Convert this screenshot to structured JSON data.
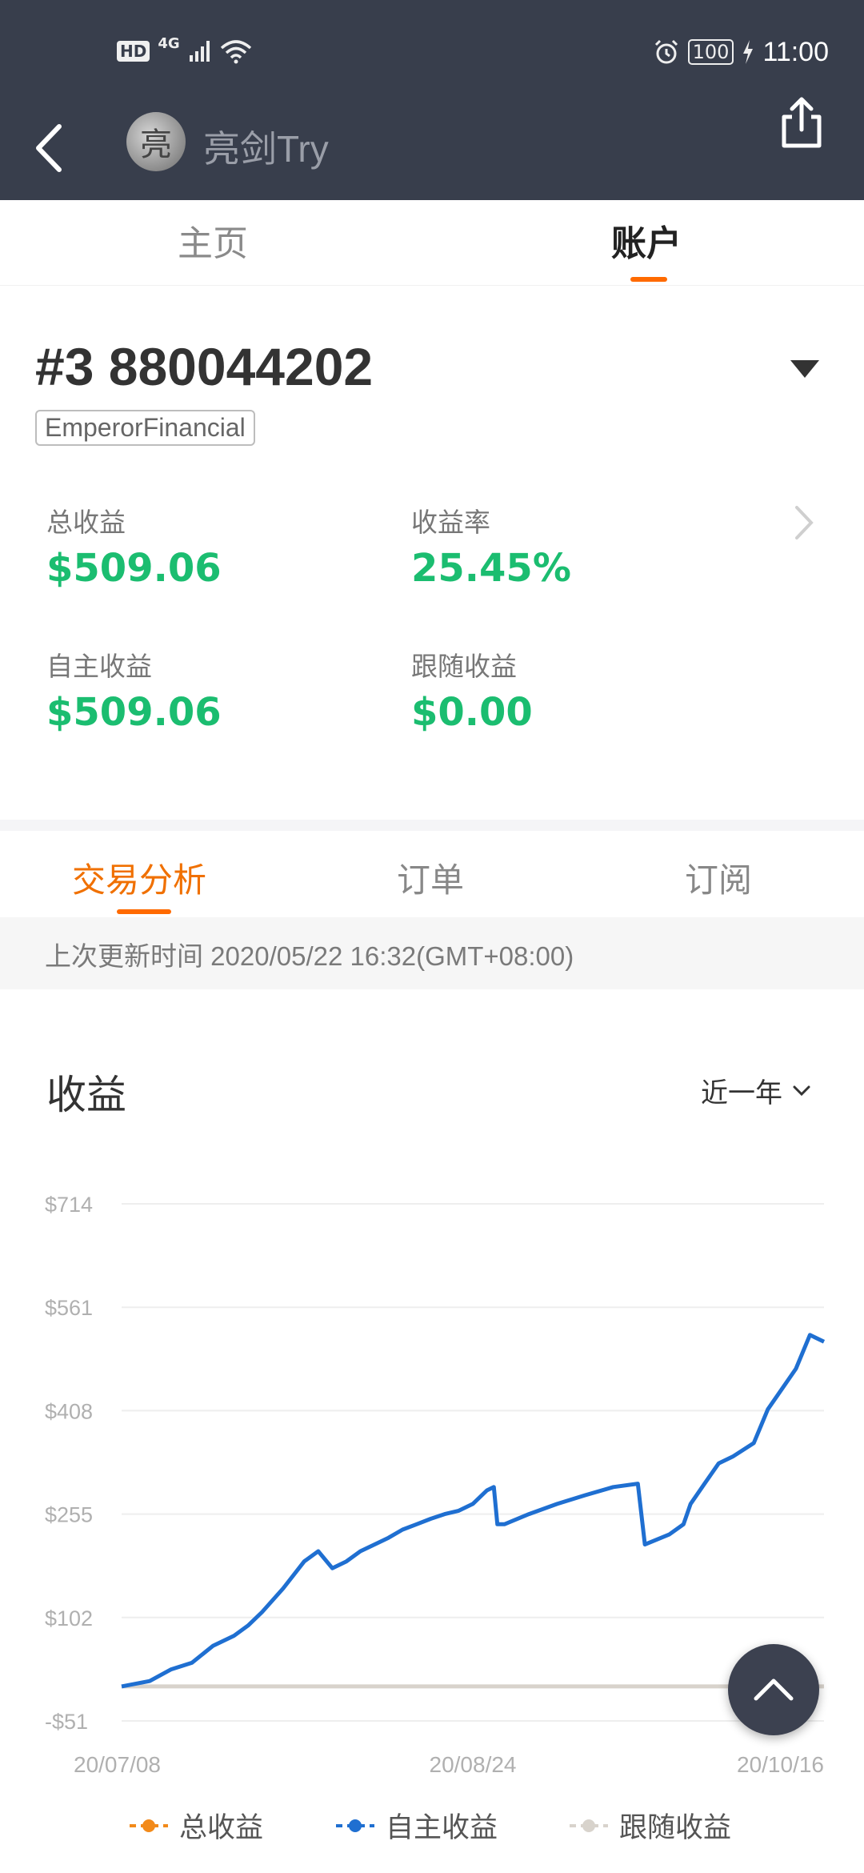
{
  "status_bar": {
    "hd": "HD",
    "network": "4G",
    "battery": "100",
    "time": "11:00"
  },
  "app_bar": {
    "title": "亮剑Try",
    "avatar_text": "亮"
  },
  "top_tabs": [
    {
      "label": "主页",
      "active": false
    },
    {
      "label": "账户",
      "active": true
    }
  ],
  "account": {
    "id": "#3 880044202",
    "broker": "EmperorFinancial"
  },
  "stats": [
    {
      "label": "总收益",
      "value": "$509.06"
    },
    {
      "label": "收益率",
      "value": "25.45%"
    },
    {
      "label": "自主收益",
      "value": "$509.06"
    },
    {
      "label": "跟随收益",
      "value": "$0.00"
    }
  ],
  "sub_tabs": [
    {
      "label": "交易分析",
      "active": true
    },
    {
      "label": "订单",
      "active": false
    },
    {
      "label": "订阅",
      "active": false
    }
  ],
  "last_update": "上次更新时间 2020/05/22 16:32(GMT+08:00)",
  "earnings_section": {
    "title": "收益",
    "range": "近一年"
  },
  "colors": {
    "accent": "#ff6a00",
    "positive": "#1bbd70",
    "series_total": "#f28a1a",
    "series_self": "#1f6fd1",
    "series_follow": "#d8d3cc"
  },
  "chart_data": {
    "type": "line",
    "y_ticks": [
      "$714",
      "$561",
      "$408",
      "$255",
      "$102",
      "-$51"
    ],
    "ylim": [
      -51,
      714
    ],
    "x_ticks": [
      "20/07/08",
      "20/08/24",
      "20/10/16"
    ],
    "x_tick_pos": [
      0.0,
      0.5,
      1.0
    ],
    "legend": [
      {
        "name": "总收益",
        "color": "#f28a1a"
      },
      {
        "name": "自主收益",
        "color": "#1f6fd1"
      },
      {
        "name": "跟随收益",
        "color": "#d8d3cc"
      }
    ],
    "series": [
      {
        "name": "自主收益",
        "color": "#1f6fd1",
        "x": [
          0,
          0.04,
          0.07,
          0.1,
          0.13,
          0.16,
          0.18,
          0.2,
          0.23,
          0.26,
          0.28,
          0.3,
          0.32,
          0.34,
          0.36,
          0.38,
          0.4,
          0.42,
          0.44,
          0.46,
          0.48,
          0.5,
          0.52,
          0.53,
          0.535,
          0.545,
          0.58,
          0.62,
          0.66,
          0.7,
          0.735,
          0.745,
          0.78,
          0.8,
          0.81,
          0.83,
          0.85,
          0.87,
          0.9,
          0.92,
          0.94,
          0.96,
          0.98,
          1.0
        ],
        "y": [
          0,
          8,
          25,
          35,
          60,
          75,
          90,
          110,
          145,
          185,
          200,
          175,
          185,
          200,
          210,
          220,
          232,
          240,
          248,
          255,
          260,
          270,
          290,
          295,
          240,
          240,
          255,
          270,
          283,
          295,
          300,
          210,
          225,
          240,
          270,
          300,
          330,
          340,
          360,
          410,
          440,
          470,
          520,
          510
        ]
      },
      {
        "name": "跟随收益",
        "color": "#d8d3cc",
        "x": [
          0,
          1.0
        ],
        "y": [
          0,
          0
        ]
      }
    ]
  }
}
